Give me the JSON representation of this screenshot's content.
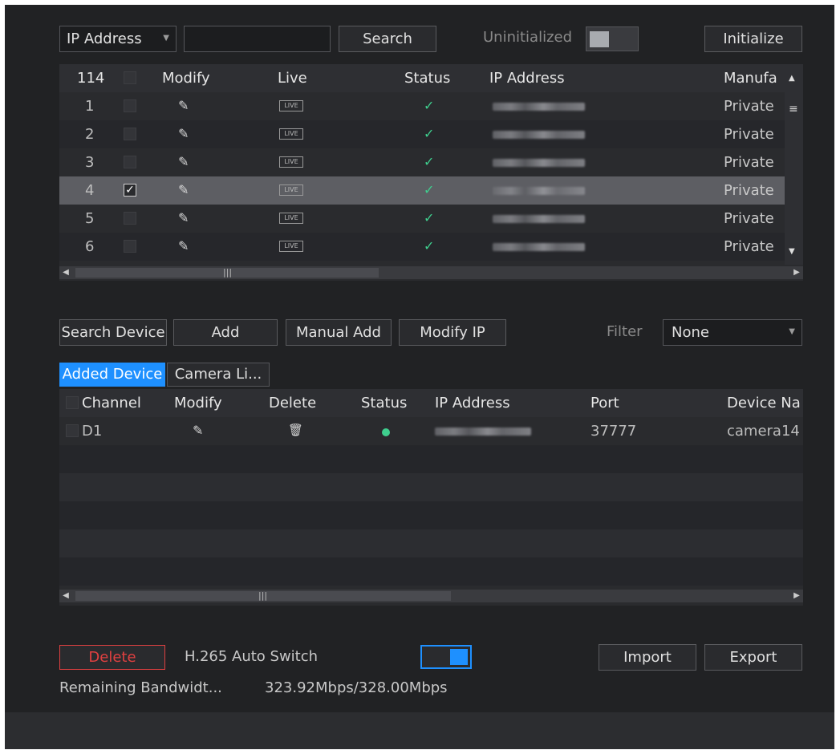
{
  "search_bar": {
    "filter_select": "IP Address",
    "search_input_value": "",
    "search_button": "Search",
    "uninitialized_label": "Uninitialized",
    "initialize_button": "Initialize"
  },
  "search_table": {
    "count": "114",
    "columns": [
      "Modify",
      "Live",
      "Status",
      "IP Address",
      "Manufa"
    ],
    "live_label": "LIVE",
    "rows": [
      {
        "num": "1",
        "manufacturer": "Private",
        "checked": false,
        "selected": false
      },
      {
        "num": "2",
        "manufacturer": "Private",
        "checked": false,
        "selected": false
      },
      {
        "num": "3",
        "manufacturer": "Private",
        "checked": false,
        "selected": false
      },
      {
        "num": "4",
        "manufacturer": "Private",
        "checked": true,
        "selected": true
      },
      {
        "num": "5",
        "manufacturer": "Private",
        "checked": false,
        "selected": false
      },
      {
        "num": "6",
        "manufacturer": "Private",
        "checked": false,
        "selected": false
      }
    ]
  },
  "actions": {
    "search_device": "Search Device",
    "add": "Add",
    "manual_add": "Manual Add",
    "modify_ip": "Modify IP",
    "filter_label": "Filter",
    "filter_value": "None"
  },
  "tabs": {
    "added_device": "Added Device",
    "camera_list": "Camera Li..."
  },
  "added_table": {
    "columns": [
      "Channel",
      "Modify",
      "Delete",
      "Status",
      "IP Address",
      "Port",
      "Device Na"
    ],
    "rows": [
      {
        "channel": "D1",
        "port": "37777",
        "device_name": "camera14"
      }
    ]
  },
  "footer": {
    "delete_button": "Delete",
    "h265_label": "H.265 Auto Switch",
    "import_button": "Import",
    "export_button": "Export",
    "bandwidth_label": "Remaining Bandwidt...",
    "bandwidth_value": "323.92Mbps/328.00Mbps"
  },
  "colors": {
    "accent": "#1e90ff",
    "status_ok": "#3fcf8e",
    "delete_red": "#e04040"
  }
}
